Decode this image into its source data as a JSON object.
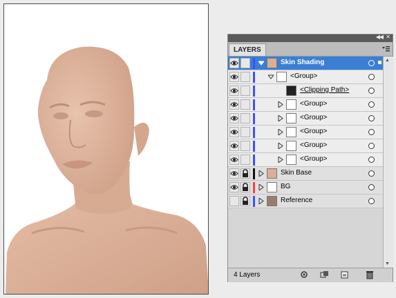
{
  "panel": {
    "tab_label": "LAYERS",
    "footer_count": "4 Layers"
  },
  "layers": [
    {
      "label": "Skin Shading",
      "selected": true,
      "level": 0,
      "expanded": true,
      "color": "#3c50ff",
      "eye": true,
      "lock": false
    },
    {
      "label": "<Group>",
      "level": 1,
      "expanded": true,
      "color": "#3c50ff",
      "eye": true,
      "lock": false
    },
    {
      "label": "<Clipping Path>",
      "level": 2,
      "clipping": true,
      "color": "#3c50ff",
      "eye": true,
      "lock": false
    },
    {
      "label": "<Group>",
      "level": 2,
      "expanded": false,
      "color": "#3c50ff",
      "eye": true,
      "lock": false
    },
    {
      "label": "<Group>",
      "level": 2,
      "expanded": false,
      "color": "#3c50ff",
      "eye": true,
      "lock": false
    },
    {
      "label": "<Group>",
      "level": 2,
      "expanded": false,
      "color": "#3c50ff",
      "eye": true,
      "lock": false
    },
    {
      "label": "<Group>",
      "level": 2,
      "expanded": false,
      "color": "#3c50ff",
      "eye": true,
      "lock": false
    },
    {
      "label": "<Group>",
      "level": 2,
      "expanded": false,
      "color": "#3c50ff",
      "eye": true,
      "lock": false
    },
    {
      "label": "Skin Base",
      "level": 0,
      "expanded": false,
      "color": "#111111",
      "eye": true,
      "lock": true
    },
    {
      "label": "BG",
      "level": 0,
      "expanded": false,
      "color": "#ff3c3c",
      "eye": true,
      "lock": true
    },
    {
      "label": "Reference",
      "level": 0,
      "expanded": false,
      "color": "#3c50ff",
      "eye": false,
      "lock": true
    }
  ],
  "icons": {
    "eye": "eye-icon",
    "lock": "lock-icon",
    "panel_menu": "panel-menu-icon",
    "make_clipping_mask": "clipping-mask-icon",
    "new_sublayer": "new-sublayer-icon",
    "new_layer": "new-layer-icon",
    "delete": "trash-icon"
  },
  "colors": {
    "selection": "#3a7fd4",
    "skin": "#dcae95"
  }
}
